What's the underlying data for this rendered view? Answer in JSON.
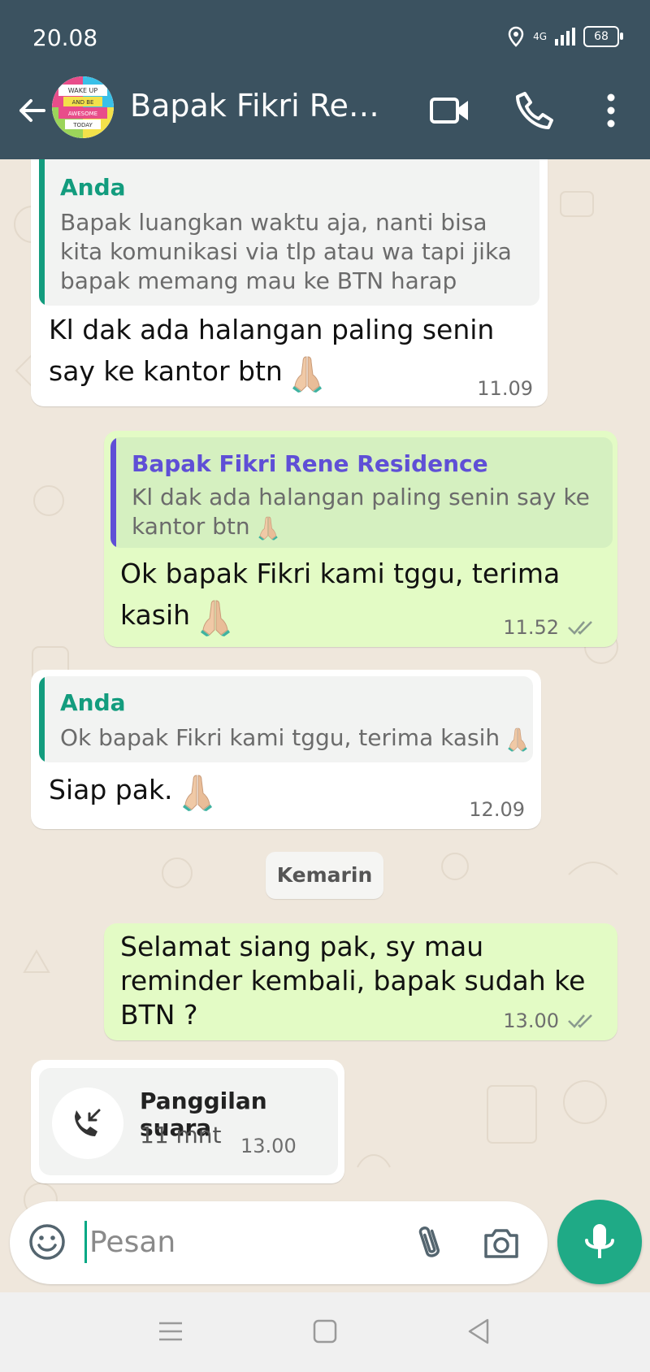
{
  "status_bar": {
    "time": "20.08",
    "network": "4G",
    "battery": "68"
  },
  "header": {
    "title": "Bapak Fikri Rene…",
    "avatar_text": [
      "WAKE UP",
      "AND BE",
      "AWESOME",
      "TODAY"
    ]
  },
  "messages": [
    {
      "direction": "incoming",
      "quote": {
        "sender": "Anda",
        "text": "Bapak luangkan waktu aja, nanti bisa kita komunikasi via tlp atau wa tapi jika bapak memang mau ke BTN harap dapat melu…"
      },
      "text": "Kl dak ada halangan paling senin say ke kantor btn",
      "time": "11.09"
    },
    {
      "direction": "outgoing",
      "quote": {
        "sender": "Bapak Fikri Rene Residence",
        "text": "Kl dak ada halangan paling senin say ke kantor btn"
      },
      "text": "Ok bapak Fikri kami tggu, terima kasih",
      "time": "11.52"
    },
    {
      "direction": "incoming",
      "quote": {
        "sender": "Anda",
        "text": "Ok bapak Fikri kami tggu, terima kasih"
      },
      "text": "Siap pak.",
      "time": "12.09"
    },
    {
      "direction": "outgoing",
      "text": "Selamat siang pak, sy mau reminder kembali, bapak sudah ke BTN ?",
      "time": "13.00"
    }
  ],
  "date_divider": "Kemarin",
  "voice_call": {
    "label": "Panggilan suara",
    "duration": "11 mnt",
    "time": "13.00"
  },
  "composer": {
    "placeholder": "Pesan"
  },
  "colors": {
    "header": "#3b5260",
    "accent": "#00a884",
    "outgoing": "#e3fbc5",
    "incoming": "#ffffff",
    "quote_sender_in": "#139c7e",
    "quote_sender_out": "#5f4fd6"
  }
}
